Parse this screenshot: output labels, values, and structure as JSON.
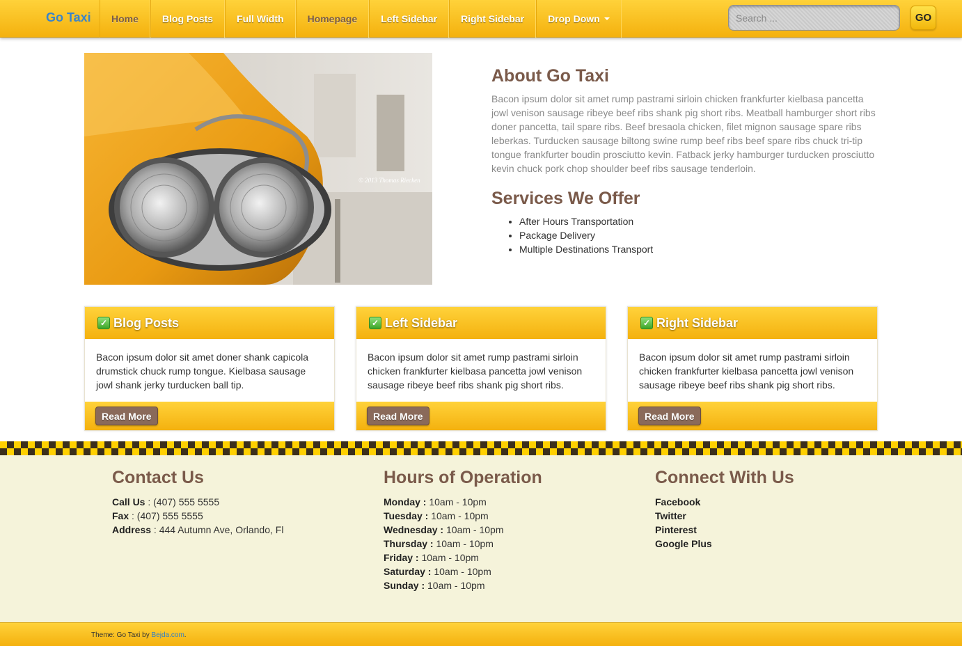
{
  "header": {
    "brand": "Go Taxi",
    "nav": [
      {
        "label": "Home"
      },
      {
        "label": "Blog Posts"
      },
      {
        "label": "Full Width"
      },
      {
        "label": "Homepage"
      },
      {
        "label": "Left Sidebar"
      },
      {
        "label": "Right Sidebar"
      },
      {
        "label": "Drop Down"
      }
    ],
    "search_placeholder": "Search ...",
    "search_button": "GO"
  },
  "hero": {
    "image_credit": "© 2013 Thomas Riecken"
  },
  "about": {
    "title": "About Go Taxi",
    "text": "Bacon ipsum dolor sit amet rump pastrami sirloin chicken frankfurter kielbasa pancetta jowl venison sausage ribeye beef ribs shank pig short ribs. Meatball hamburger short ribs doner pancetta, tail spare ribs. Beef bresaola chicken, filet mignon sausage spare ribs leberkas. Turducken sausage biltong swine rump beef ribs beef spare ribs chuck tri-tip tongue frankfurter boudin prosciutto kevin. Fatback jerky hamburger turducken prosciutto kevin chuck pork chop shoulder beef ribs sausage tenderloin."
  },
  "services": {
    "title": "Services We Offer",
    "items": [
      "After Hours Transportation",
      "Package Delivery",
      "Multiple Destinations Transport"
    ]
  },
  "cards": [
    {
      "title": "Blog Posts",
      "text": "Bacon ipsum dolor sit amet doner shank capicola drumstick chuck rump tongue. Kielbasa sausage jowl shank jerky turducken ball tip.",
      "button": "Read More"
    },
    {
      "title": "Left Sidebar",
      "text": "Bacon ipsum dolor sit amet rump pastrami sirloin chicken frankfurter kielbasa pancetta jowl venison sausage ribeye beef ribs shank pig short ribs.",
      "button": "Read More"
    },
    {
      "title": "Right Sidebar",
      "text": "Bacon ipsum dolor sit amet rump pastrami sirloin chicken frankfurter kielbasa pancetta jowl venison sausage ribeye beef ribs shank pig short ribs.",
      "button": "Read More"
    }
  ],
  "footer": {
    "contact": {
      "title": "Contact Us",
      "lines": [
        {
          "label": "Call Us",
          "value": " : (407) 555 5555"
        },
        {
          "label": "Fax",
          "value": " : (407) 555 5555"
        },
        {
          "label": "Address",
          "value": " : 444 Autumn Ave, Orlando, Fl"
        }
      ]
    },
    "hours": {
      "title": "Hours of Operation",
      "lines": [
        {
          "label": "Monday :",
          "value": " 10am - 10pm"
        },
        {
          "label": "Tuesday :",
          "value": " 10am - 10pm"
        },
        {
          "label": "Wednesday :",
          "value": " 10am - 10pm"
        },
        {
          "label": "Thursday :",
          "value": " 10am - 10pm"
        },
        {
          "label": "Friday :",
          "value": " 10am - 10pm"
        },
        {
          "label": "Saturday :",
          "value": " 10am - 10pm"
        },
        {
          "label": "Sunday :",
          "value": " 10am - 10pm"
        }
      ]
    },
    "connect": {
      "title": "Connect With Us",
      "links": [
        "Facebook",
        "Twitter",
        "Pinterest",
        "Google Plus"
      ]
    },
    "credit_prefix": "Theme: Go Taxi by ",
    "credit_link": "Bejda.com",
    "credit_suffix": "."
  },
  "colors": {
    "accent_yellow": "#f4b10e",
    "heading_brown": "#7a5a4a",
    "brand_blue": "#3a84c9",
    "footer_bg": "#f5f3da"
  }
}
